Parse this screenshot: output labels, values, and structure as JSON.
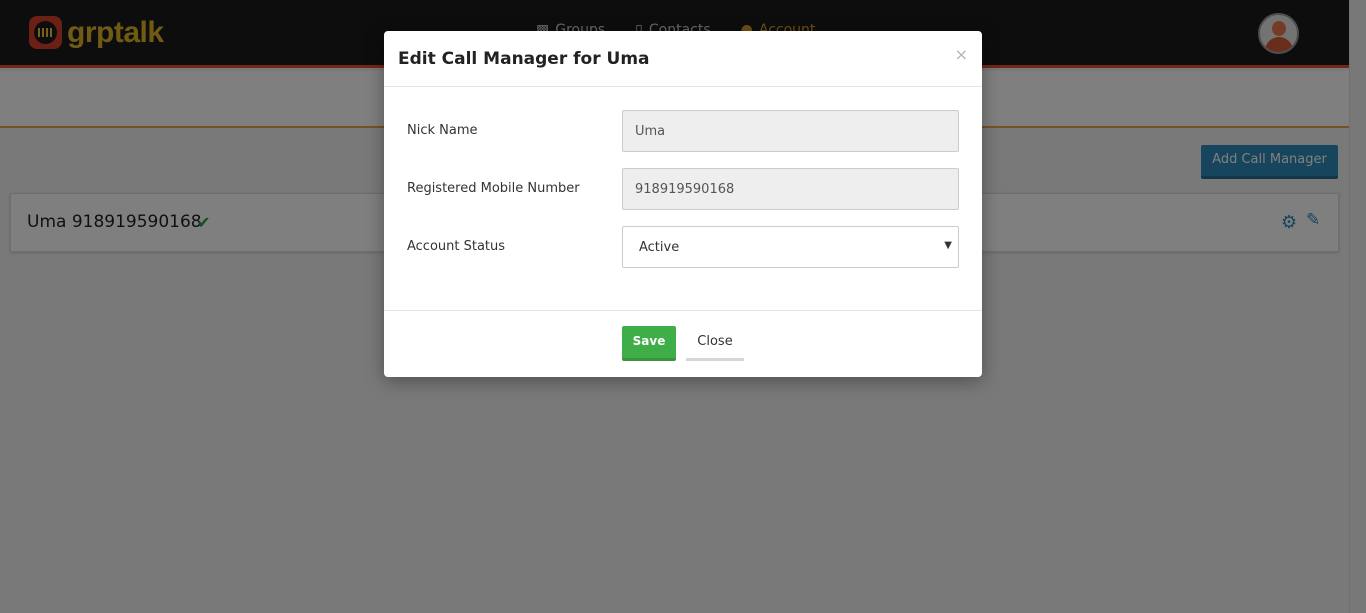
{
  "app": {
    "logo_text": "grptalk",
    "nav": [
      {
        "label": "Groups",
        "icon": "groups-icon"
      },
      {
        "label": "Contacts",
        "icon": "contacts-icon"
      },
      {
        "label": "Account",
        "icon": "account-icon"
      }
    ],
    "add_button_label": "Add Call Manager",
    "manager": {
      "name": "Uma",
      "number": "918919590168",
      "display": "Uma 918919590168"
    }
  },
  "modal": {
    "title": "Edit Call Manager for Uma",
    "close_glyph": "×",
    "fields": {
      "nick_name": {
        "label": "Nick Name",
        "value": "Uma"
      },
      "mobile": {
        "label": "Registered Mobile Number",
        "value": "918919590168"
      },
      "status": {
        "label": "Account Status",
        "value": "Active"
      }
    },
    "save_label": "Save",
    "close_label": "Close"
  },
  "colors": {
    "topbar": "#1b1b1b",
    "brand_orange": "#e64a2e",
    "logo_yellow": "#e3b427",
    "primary_blue": "#2d8bba",
    "save_green": "#3fae49",
    "verified_green": "#1f9e3a"
  }
}
